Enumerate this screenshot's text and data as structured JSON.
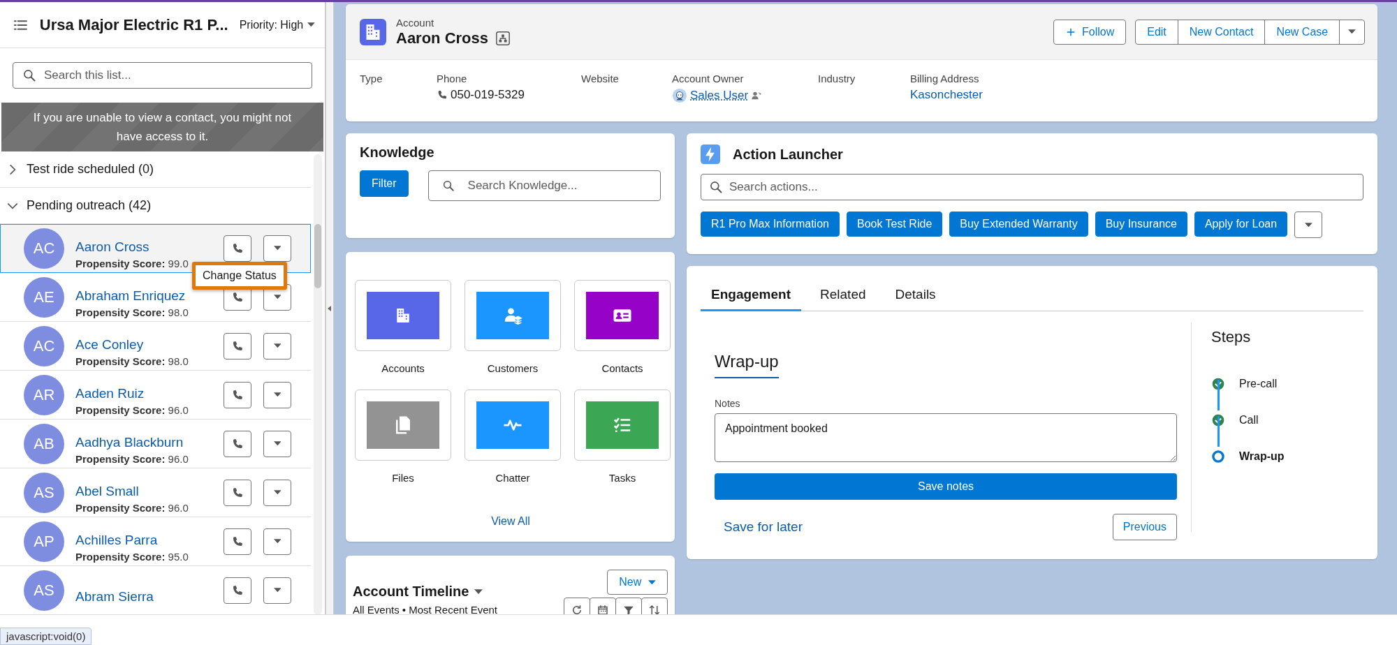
{
  "sidebar": {
    "title": "Ursa Major Electric R1 P...",
    "filter": "Priority: High",
    "search": {
      "placeholder": "Search this list..."
    },
    "notice": "If you are unable to view a contact, you might not have access to it.",
    "groups": [
      {
        "label": "Test ride scheduled (0)",
        "expanded": false
      },
      {
        "label": "Pending outreach (42)",
        "expanded": true,
        "contacts": [
          {
            "initials": "AC",
            "name": "Aaron Cross",
            "score_label": "Propensity Score:",
            "score": "99.0",
            "selected": true
          },
          {
            "initials": "AE",
            "name": "Abraham Enriquez",
            "score_label": "Propensity Score:",
            "score": "98.0",
            "selected": false
          },
          {
            "initials": "AC",
            "name": "Ace Conley",
            "score_label": "Propensity Score:",
            "score": "98.0",
            "selected": false
          },
          {
            "initials": "AR",
            "name": "Aaden Ruiz",
            "score_label": "Propensity Score:",
            "score": "96.0",
            "selected": false
          },
          {
            "initials": "AB",
            "name": "Aadhya Blackburn",
            "score_label": "Propensity Score:",
            "score": "96.0",
            "selected": false
          },
          {
            "initials": "AS",
            "name": "Abel Small",
            "score_label": "Propensity Score:",
            "score": "96.0",
            "selected": false
          },
          {
            "initials": "AP",
            "name": "Achilles Parra",
            "score_label": "Propensity Score:",
            "score": "95.0",
            "selected": false
          },
          {
            "initials": "AS",
            "name": "Abram Sierra",
            "selected": false
          }
        ]
      }
    ]
  },
  "menu": {
    "items": [
      "Change Status"
    ]
  },
  "record": {
    "object": "Account",
    "name": "Aaron Cross",
    "follow": "Follow",
    "actions": [
      "Edit",
      "New Contact",
      "New Case"
    ],
    "fields": [
      {
        "label": "Type",
        "kind": "empty"
      },
      {
        "label": "Phone",
        "kind": "phone",
        "value": "050-019-5329"
      },
      {
        "label": "Website",
        "kind": "empty"
      },
      {
        "label": "Account Owner",
        "kind": "user",
        "value": "Sales User"
      },
      {
        "label": "Industry",
        "kind": "empty"
      },
      {
        "label": "Billing Address",
        "kind": "link",
        "value": "Kasonchester"
      }
    ]
  },
  "knowledge": {
    "title": "Knowledge",
    "filter": "Filter",
    "search": {
      "placeholder": "Search Knowledge..."
    }
  },
  "apps": {
    "items": [
      {
        "label": "Accounts",
        "kind": "building",
        "color": "#5867e8"
      },
      {
        "label": "Customers",
        "kind": "customers",
        "color": "#1b96ff"
      },
      {
        "label": "Contacts",
        "kind": "card",
        "color": "#9602c7"
      },
      {
        "label": "Files",
        "kind": "files",
        "color": "#939393"
      },
      {
        "label": "Chatter",
        "kind": "pulse",
        "color": "#1b96ff"
      },
      {
        "label": "Tasks",
        "kind": "tasks",
        "color": "#3ba755"
      }
    ],
    "view_all": "View All"
  },
  "timeline": {
    "title": "Account Timeline",
    "subtitle": "All Events • Most Recent Event",
    "new_button": "New"
  },
  "launcher": {
    "title": "Action Launcher",
    "search": {
      "placeholder": "Search actions..."
    },
    "actions": [
      "R1 Pro Max Information",
      "Book Test Ride",
      "Buy Extended Warranty",
      "Buy Insurance",
      "Apply for Loan"
    ]
  },
  "engagement": {
    "tabs": [
      {
        "label": "Engagement",
        "selected": true
      },
      {
        "label": "Related",
        "selected": false
      },
      {
        "label": "Details",
        "selected": false
      }
    ],
    "section": "Wrap-up",
    "notes_label": "Notes",
    "notes": "Appointment booked",
    "save": "Save notes",
    "save_later": "Save for later",
    "previous": "Previous",
    "steps_title": "Steps",
    "steps": [
      {
        "label": "Pre-call",
        "complete": true,
        "current": false
      },
      {
        "label": "Call",
        "complete": true,
        "current": false
      },
      {
        "label": "Wrap-up",
        "complete": false,
        "current": true
      }
    ]
  },
  "status_tooltip": "javascript:void(0)"
}
